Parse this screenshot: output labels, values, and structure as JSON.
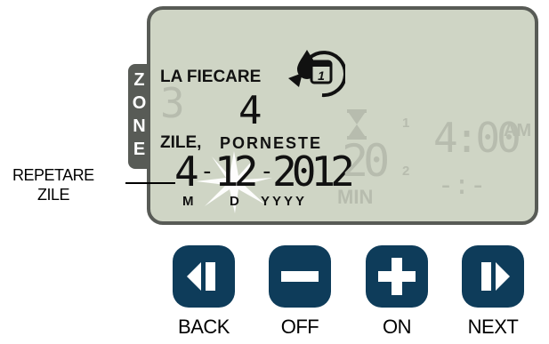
{
  "zone_tab": {
    "letters": [
      "Z",
      "O",
      "N",
      "E"
    ]
  },
  "lcd": {
    "title": "LA FIECARE",
    "zone_number": "3",
    "repeat_number": "4",
    "days_label": "ZILE,",
    "starts_label": "PORNESTE",
    "date": {
      "month": "4",
      "sep1": "-",
      "day": "12",
      "sep2": "-",
      "year": "2012"
    },
    "date_labels": {
      "month": "M",
      "day": "D",
      "year": "YYYY"
    },
    "duration_value": "20",
    "duration_unit": "MIN",
    "start_index_1": "1",
    "start_index_2": "2",
    "start_time_1": "4:00",
    "start_time_1_suffix": "AM",
    "start_time_2": "-:-"
  },
  "callout": {
    "line1": "REPETARE",
    "line2": "ZILE"
  },
  "buttons": [
    {
      "label": "BACK",
      "icon": "back-icon"
    },
    {
      "label": "OFF",
      "icon": "minus-icon"
    },
    {
      "label": "ON",
      "icon": "plus-icon"
    },
    {
      "label": "NEXT",
      "icon": "next-icon"
    }
  ],
  "colors": {
    "lcd_background": "#cfd5c5",
    "bezel": "#585b56",
    "button": "#0e3c5a",
    "ghost_segment": "#b7bcae"
  }
}
